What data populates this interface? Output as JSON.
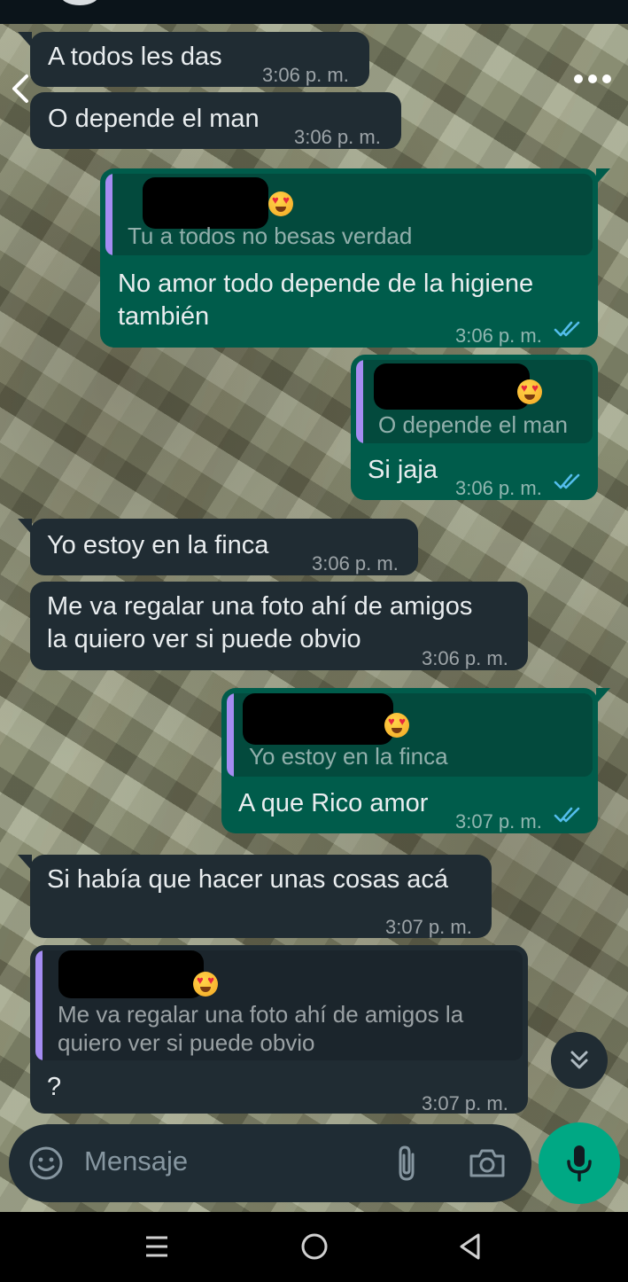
{
  "composer": {
    "placeholder": "Mensaje"
  },
  "messages": [
    {
      "direction": "in",
      "text": "A todos les das",
      "time": "3:06 p. m."
    },
    {
      "direction": "in",
      "text": "O depende el man",
      "time": "3:06 p. m."
    },
    {
      "direction": "out",
      "quote": {
        "text": "Tu a todos no besas verdad"
      },
      "text": "No amor todo depende de la higiene\ntambién",
      "time": "3:06 p. m.",
      "status": "read"
    },
    {
      "direction": "out",
      "quote": {
        "text": "O depende el man"
      },
      "text": "Si jaja",
      "time": "3:06 p. m.",
      "status": "read"
    },
    {
      "direction": "in",
      "text": "Yo estoy en la finca",
      "time": "3:06 p. m."
    },
    {
      "direction": "in",
      "text": "Me va regalar una foto ahí de amigos\nla quiero ver si puede obvio",
      "time": "3:06 p. m."
    },
    {
      "direction": "out",
      "quote": {
        "text": "Yo estoy en la finca"
      },
      "text": "A que Rico amor",
      "time": "3:07 p. m.",
      "status": "read"
    },
    {
      "direction": "in",
      "text": "Si había que hacer unas cosas acá",
      "time": "3:07 p. m."
    },
    {
      "direction": "in",
      "quote": {
        "text": "Me va regalar una foto ahí de amigos la\nquiero ver si puede obvio"
      },
      "text": "?",
      "time": "3:07 p. m."
    }
  ],
  "icons": {
    "back": "back-arrow-icon",
    "menu": "more-vertical-icon",
    "scroll": "double-chevron-down-icon",
    "emoji": "emoji-icon",
    "attach": "paperclip-icon",
    "camera": "camera-icon",
    "mic": "microphone-icon"
  },
  "colors": {
    "incoming_bubble": "#202c33",
    "outgoing_bubble": "#005c4b",
    "read_ticks": "#53bdeb",
    "quote_accent": "#a58cf2",
    "mic_button": "#00a884"
  }
}
